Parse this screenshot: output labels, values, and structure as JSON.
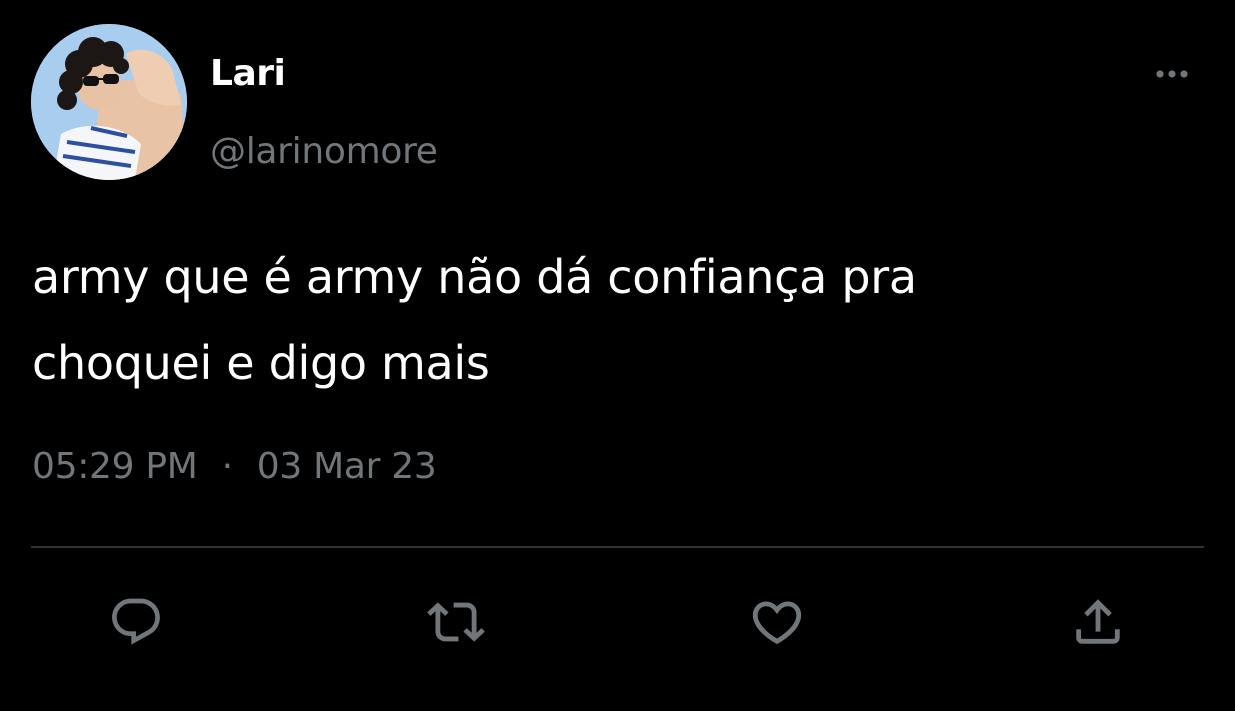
{
  "tweet": {
    "display_name": "Lari",
    "handle": "@larinomore",
    "text_lines": [
      "army que é army não dá confiança pra",
      "choquei e digo mais"
    ],
    "time": "05:29 PM",
    "separator": "·",
    "date": "03 Mar 23"
  },
  "icons": {
    "more": "more-horizontal-icon",
    "reply": "reply-icon",
    "retweet": "retweet-icon",
    "like": "heart-icon",
    "share": "share-icon"
  },
  "colors": {
    "background": "#000000",
    "primary_text": "#ffffff",
    "secondary_text": "#71767b",
    "divider": "#2f3336"
  }
}
